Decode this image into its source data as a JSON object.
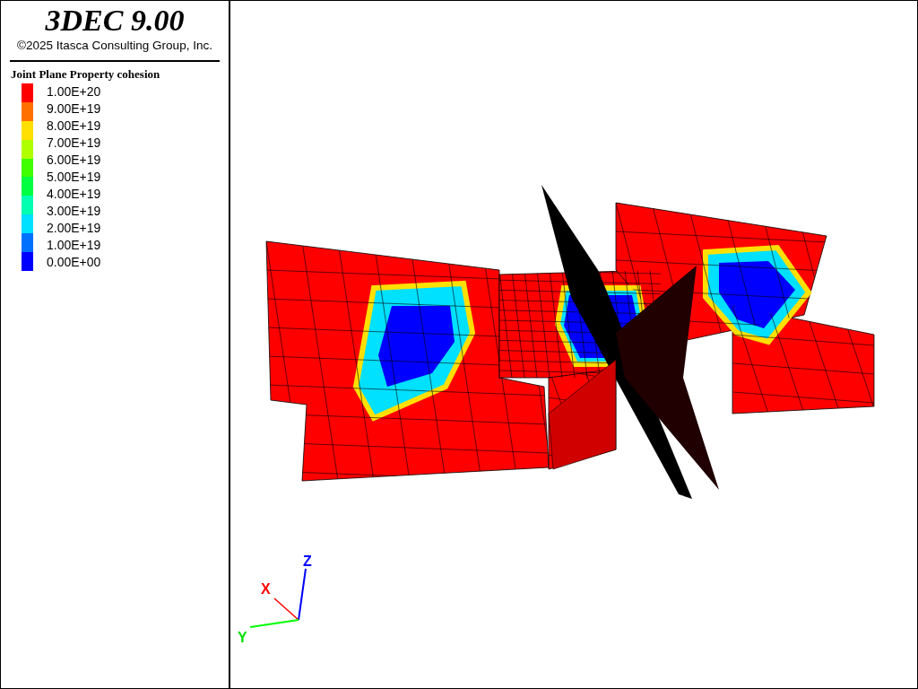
{
  "title_panel": {
    "title": "3DEC 9.00",
    "copyright": "©2025 Itasca Consulting Group, Inc."
  },
  "legend": {
    "title": "Joint Plane Property cohesion",
    "labels": [
      "1.00E+20",
      "9.00E+19",
      "8.00E+19",
      "7.00E+19",
      "6.00E+19",
      "5.00E+19",
      "4.00E+19",
      "3.00E+19",
      "2.00E+19",
      "1.00E+19",
      "0.00E+00"
    ],
    "bands": [
      {
        "color": "#ff0000"
      },
      {
        "color": "#ff7000"
      },
      {
        "color": "#ffe000"
      },
      {
        "color": "#b0ff00"
      },
      {
        "color": "#40ff00"
      },
      {
        "color": "#00ff40"
      },
      {
        "color": "#00ffb0"
      },
      {
        "color": "#00e0ff"
      },
      {
        "color": "#0070ff"
      },
      {
        "color": "#0000ff"
      }
    ]
  },
  "axes": {
    "x_label": "X",
    "y_label": "Y",
    "z_label": "Z"
  }
}
